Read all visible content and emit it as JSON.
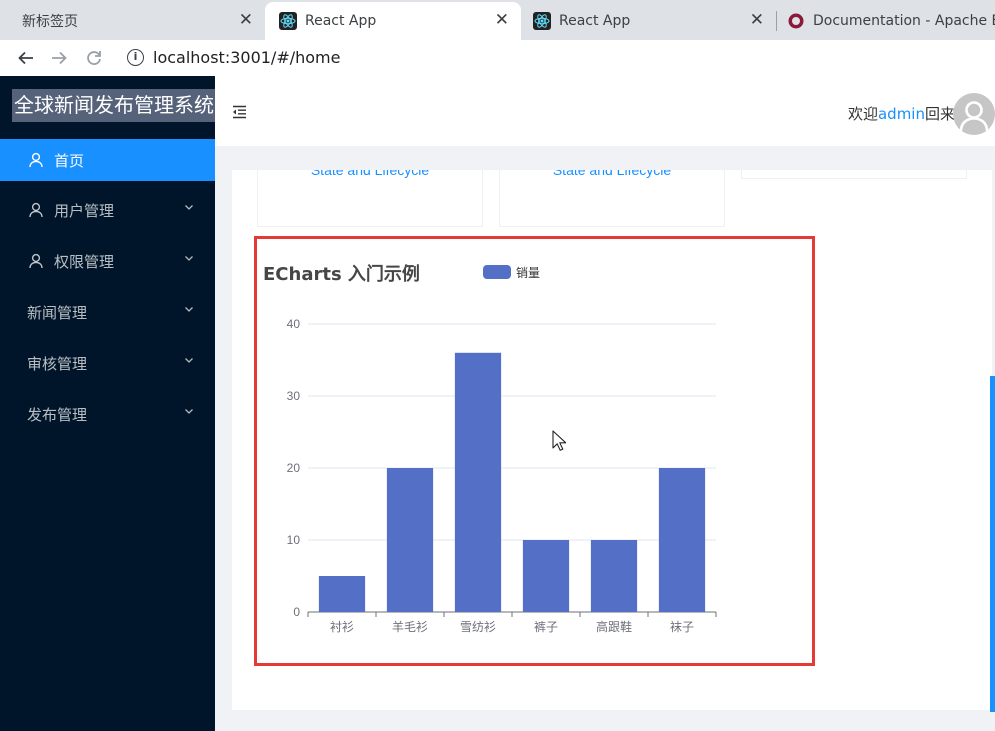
{
  "browser": {
    "tabs": [
      {
        "title": "新标签页",
        "active": false,
        "favicon": "none"
      },
      {
        "title": "React App",
        "active": true,
        "favicon": "react-icon"
      },
      {
        "title": "React App",
        "active": false,
        "favicon": "react-icon"
      },
      {
        "title": "Documentation - Apache ECh",
        "active": false,
        "favicon": "echarts-icon"
      }
    ],
    "close_glyph": "✕",
    "address": {
      "url": "localhost:3001/#/home",
      "info_glyph": "i"
    }
  },
  "app": {
    "title": "全球新闻发布管理系统",
    "sidebar": {
      "items": [
        {
          "label": "首页",
          "icon": "user-icon",
          "selected": true,
          "has_submenu": false
        },
        {
          "label": "用户管理",
          "icon": "user-icon",
          "selected": false,
          "has_submenu": true
        },
        {
          "label": "权限管理",
          "icon": "user-icon",
          "selected": false,
          "has_submenu": true
        },
        {
          "label": "新闻管理",
          "icon": "none",
          "selected": false,
          "has_submenu": true
        },
        {
          "label": "审核管理",
          "icon": "none",
          "selected": false,
          "has_submenu": true
        },
        {
          "label": "发布管理",
          "icon": "none",
          "selected": false,
          "has_submenu": true
        }
      ]
    },
    "header": {
      "welcome_prefix": "欢迎",
      "username": "admin",
      "welcome_suffix": "回来",
      "fold_icon": "menu-fold-icon",
      "avatar_icon": "user-avatar-icon"
    },
    "cards": [
      {
        "link": "State and Lifecycle"
      },
      {
        "link": "State and Lifecycle"
      }
    ]
  },
  "colors": {
    "sidebar_bg": "#001529",
    "selected": "#1890ff",
    "bar": "#5470c6",
    "highlight_border": "#e53935"
  },
  "chart_data": {
    "type": "bar",
    "title": "ECharts 入门示例",
    "legend": [
      "销量"
    ],
    "legend_position": "top",
    "categories": [
      "衬衫",
      "羊毛衫",
      "雪纺衫",
      "裤子",
      "高跟鞋",
      "袜子"
    ],
    "series": [
      {
        "name": "销量",
        "values": [
          5,
          20,
          36,
          10,
          10,
          20
        ]
      }
    ],
    "ylim": [
      0,
      40
    ],
    "yticks": [
      0,
      10,
      20,
      30,
      40
    ],
    "grid": true
  }
}
